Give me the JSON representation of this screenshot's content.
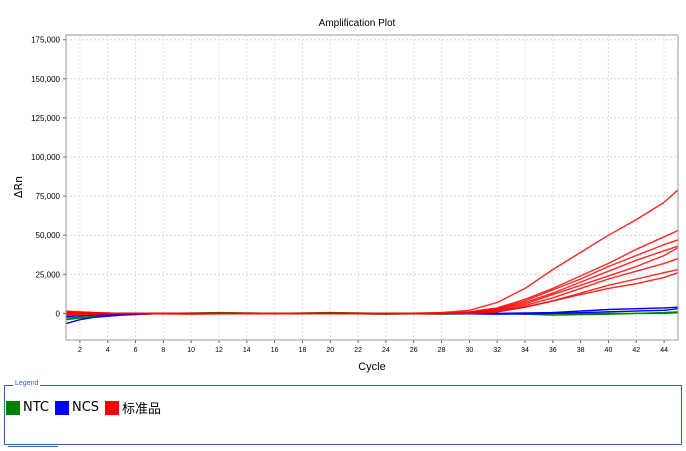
{
  "chart_data": {
    "type": "line",
    "title": "Amplification Plot",
    "xlabel": "Cycle",
    "ylabel": "ΔRn",
    "xlim": [
      1,
      45
    ],
    "ylim": [
      -17000,
      178000
    ],
    "x_ticks": [
      2,
      4,
      6,
      8,
      10,
      12,
      14,
      16,
      18,
      20,
      22,
      24,
      26,
      28,
      30,
      32,
      34,
      36,
      38,
      40,
      42,
      44
    ],
    "y_ticks": [
      {
        "value": 0,
        "label": "0"
      },
      {
        "value": 25000,
        "label": "25,000"
      },
      {
        "value": 50000,
        "label": "50,000"
      },
      {
        "value": 75000,
        "label": "75,000"
      },
      {
        "value": 100000,
        "label": "100,000"
      },
      {
        "value": 125000,
        "label": "125,000"
      },
      {
        "value": 150000,
        "label": "150,000"
      },
      {
        "value": 175000,
        "label": "175,000"
      }
    ],
    "grid": true,
    "groups": [
      {
        "name": "NTC",
        "color": "#008000"
      },
      {
        "name": "NCS",
        "color": "#0000ff"
      },
      {
        "name": "标准品",
        "color": "#ff0000"
      }
    ],
    "series": [
      {
        "group": "标准品",
        "x": [
          1,
          3,
          5,
          10,
          15,
          20,
          25,
          28,
          30,
          32,
          34,
          36,
          38,
          40,
          42,
          44,
          45
        ],
        "y": [
          1000,
          500,
          0,
          -500,
          0,
          0,
          0,
          500,
          2000,
          7000,
          16000,
          28000,
          39000,
          50000,
          60000,
          71000,
          79000
        ]
      },
      {
        "group": "标准品",
        "x": [
          1,
          3,
          5,
          10,
          15,
          20,
          25,
          28,
          30,
          32,
          34,
          36,
          38,
          40,
          42,
          44,
          45
        ],
        "y": [
          -1000,
          -500,
          0,
          0,
          0,
          0,
          0,
          0,
          1000,
          3500,
          9000,
          16000,
          24000,
          32000,
          41000,
          49000,
          53000
        ]
      },
      {
        "group": "标准品",
        "x": [
          1,
          3,
          5,
          10,
          15,
          20,
          25,
          28,
          30,
          32,
          34,
          36,
          38,
          40,
          42,
          44,
          45
        ],
        "y": [
          500,
          0,
          0,
          0,
          0,
          0,
          0,
          0,
          800,
          3000,
          8000,
          15000,
          22000,
          30000,
          37000,
          44000,
          47000
        ]
      },
      {
        "group": "标准品",
        "x": [
          1,
          3,
          5,
          10,
          15,
          20,
          25,
          28,
          30,
          32,
          34,
          36,
          38,
          40,
          42,
          44,
          45
        ],
        "y": [
          0,
          0,
          0,
          0,
          0,
          0,
          0,
          0,
          500,
          2500,
          7000,
          13000,
          20000,
          27000,
          34000,
          40000,
          43000
        ]
      },
      {
        "group": "标准品",
        "x": [
          1,
          3,
          5,
          10,
          15,
          20,
          25,
          28,
          30,
          32,
          34,
          36,
          38,
          40,
          42,
          44,
          45
        ],
        "y": [
          -500,
          0,
          0,
          0,
          0,
          0,
          0,
          0,
          500,
          2000,
          6000,
          12000,
          18000,
          24000,
          30000,
          37000,
          42000
        ]
      },
      {
        "group": "标准品",
        "x": [
          1,
          3,
          5,
          10,
          15,
          20,
          25,
          28,
          30,
          32,
          34,
          36,
          38,
          40,
          42,
          44,
          45
        ],
        "y": [
          1500,
          500,
          0,
          0,
          0,
          0,
          0,
          0,
          300,
          1500,
          5000,
          10000,
          16000,
          22000,
          27000,
          32000,
          35000
        ]
      },
      {
        "group": "标准品",
        "x": [
          1,
          3,
          5,
          10,
          15,
          20,
          25,
          28,
          30,
          32,
          34,
          36,
          38,
          40,
          42,
          44,
          45
        ],
        "y": [
          0,
          0,
          0,
          0,
          0,
          0,
          0,
          0,
          0,
          1000,
          4000,
          8000,
          13000,
          18000,
          22000,
          26000,
          28000
        ]
      },
      {
        "group": "标准品",
        "x": [
          1,
          3,
          5,
          10,
          15,
          20,
          25,
          28,
          30,
          32,
          34,
          36,
          38,
          40,
          42,
          44,
          45
        ],
        "y": [
          0,
          0,
          0,
          0,
          0,
          0,
          0,
          0,
          0,
          1000,
          4000,
          8000,
          12000,
          16000,
          19000,
          23000,
          26000
        ]
      },
      {
        "group": "NTC",
        "x": [
          1,
          2,
          3,
          5,
          8,
          12,
          16,
          20,
          24,
          28,
          32,
          36,
          40,
          44,
          45
        ],
        "y": [
          -4000,
          -3000,
          -2500,
          -1000,
          0,
          500,
          0,
          0,
          -500,
          0,
          0,
          -1000,
          -500,
          500,
          1000
        ]
      },
      {
        "group": "NTC",
        "x": [
          1,
          2,
          3,
          5,
          8,
          12,
          16,
          20,
          24,
          28,
          32,
          36,
          40,
          44,
          45
        ],
        "y": [
          -3000,
          -2500,
          -2000,
          -800,
          0,
          0,
          0,
          500,
          0,
          -500,
          0,
          0,
          0,
          0,
          500
        ]
      },
      {
        "group": "NCS",
        "x": [
          1,
          2,
          3,
          5,
          8,
          12,
          16,
          20,
          24,
          28,
          32,
          36,
          40,
          44,
          45
        ],
        "y": [
          -6500,
          -4000,
          -2500,
          -1000,
          0,
          0,
          0,
          0,
          0,
          0,
          0,
          500,
          2500,
          3500,
          4000
        ]
      },
      {
        "group": "NCS",
        "x": [
          1,
          2,
          3,
          5,
          8,
          12,
          16,
          20,
          24,
          28,
          32,
          36,
          40,
          44,
          45
        ],
        "y": [
          -2000,
          -1500,
          -1000,
          -500,
          0,
          0,
          0,
          0,
          0,
          0,
          -500,
          0,
          1000,
          2000,
          3000
        ]
      }
    ]
  },
  "legend": {
    "title": "Legend",
    "items": [
      {
        "label": "NTC",
        "color": "#008000"
      },
      {
        "label": "NCS",
        "color": "#0000ff"
      },
      {
        "label": "标准品",
        "color": "#ff0000"
      }
    ]
  }
}
